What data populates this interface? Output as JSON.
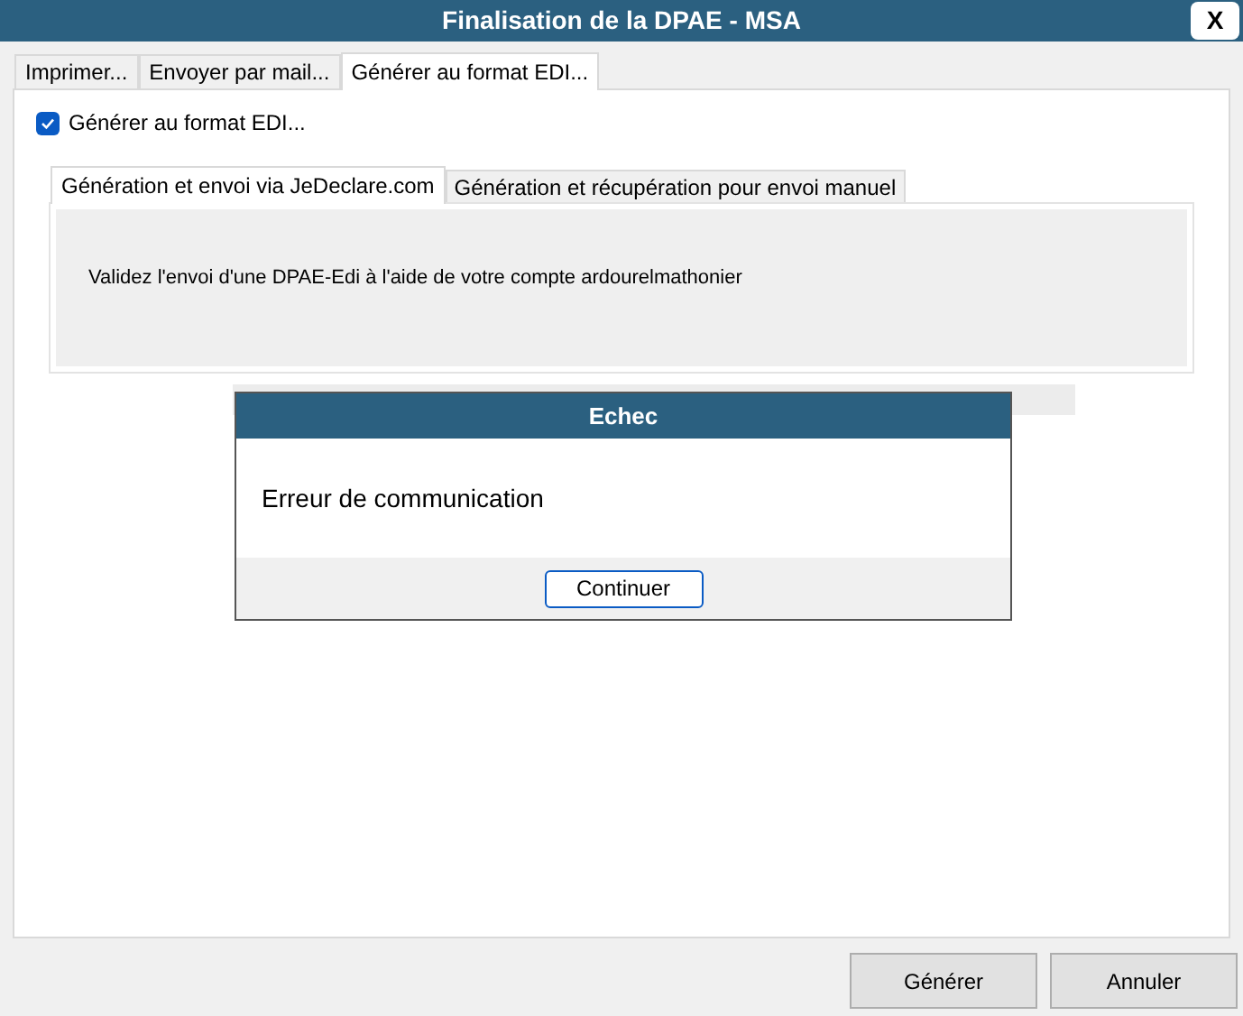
{
  "window": {
    "title": "Finalisation de la DPAE - MSA",
    "close_label": "X"
  },
  "tabs": [
    {
      "label": "Imprimer...",
      "selected": false
    },
    {
      "label": "Envoyer par mail...",
      "selected": false
    },
    {
      "label": "Générer au format EDI...",
      "selected": true
    }
  ],
  "edi_checkbox": {
    "label": "Générer au format EDI...",
    "checked": true
  },
  "inner_tabs": [
    {
      "label": "Génération et envoi via JeDeclare.com",
      "selected": true
    },
    {
      "label": "Génération et récupération pour envoi manuel",
      "selected": false
    }
  ],
  "message": "Validez l'envoi d'une DPAE-Edi à l'aide de votre compte ardourelmathonier",
  "dialog": {
    "title": "Echec",
    "message": "Erreur de communication",
    "button": "Continuer"
  },
  "buttons": [
    "Générer",
    "Annuler"
  ]
}
